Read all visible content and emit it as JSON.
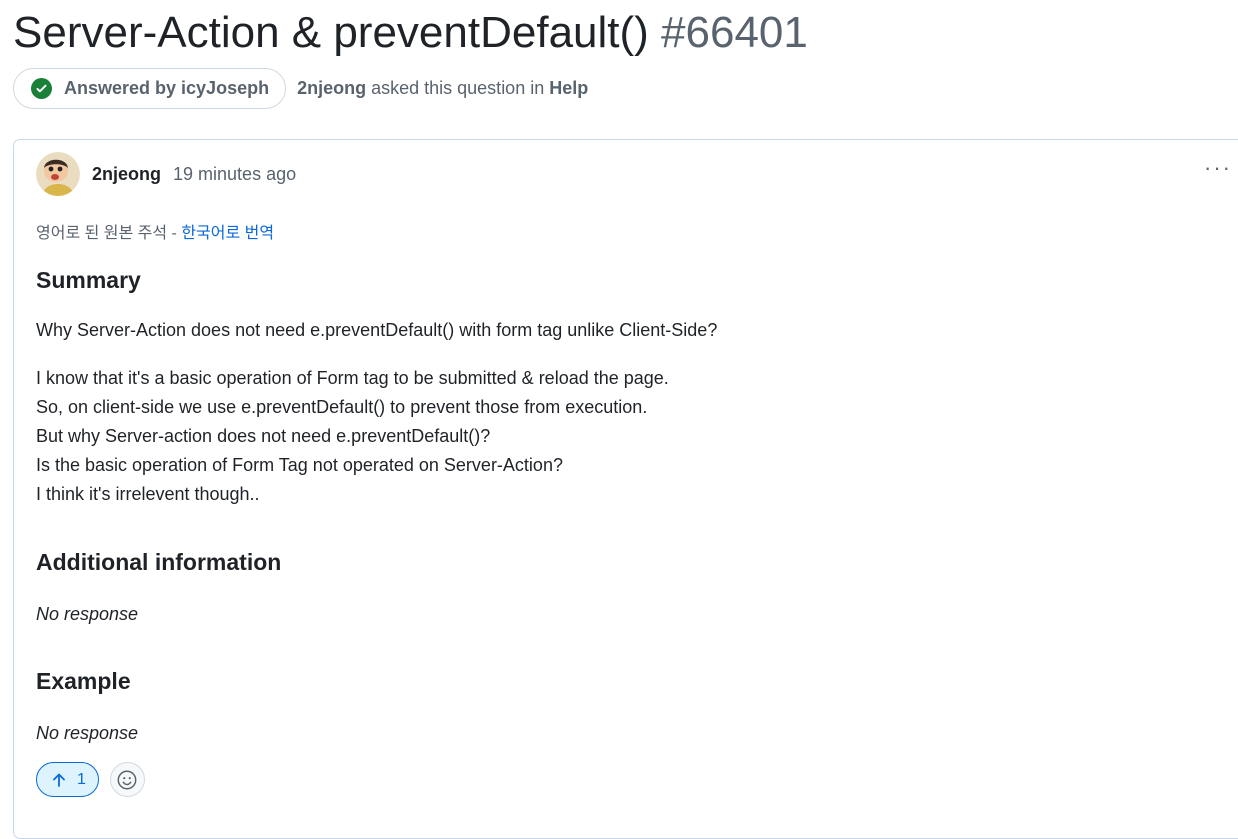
{
  "discussion": {
    "title": "Server-Action & preventDefault()",
    "number": "#66401",
    "answered_label": "Answered by icyJoseph",
    "asker": "2njeong",
    "asked_text": "asked this question in",
    "category": "Help"
  },
  "post": {
    "author": "2njeong",
    "time": "19 minutes ago",
    "translate_text": "영어로 된 원본 주석 - ",
    "translate_link": "한국어로 번역",
    "more_label": "···",
    "summary_heading": "Summary",
    "summary_line": "Why Server-Action does not need e.preventDefault() with form tag unlike Client-Side?",
    "body_lines": [
      "I know that it's a basic operation of Form tag to be submitted & reload the page.",
      "So, on client-side we use e.preventDefault() to prevent those from execution.",
      "But why Server-action does not need e.preventDefault()?",
      "Is the basic operation of Form Tag not operated on Server-Action?",
      "I think it's irrelevent though.."
    ],
    "additional_heading": "Additional information",
    "additional_text": "No response",
    "example_heading": "Example",
    "example_text": "No response"
  },
  "reactions": {
    "upvote_count": "1"
  },
  "icons": [
    "check-circle-icon",
    "kebab-icon",
    "arrow-up-icon",
    "smiley-icon"
  ],
  "colors": {
    "accent": "#0969da",
    "success": "#1a7f37",
    "muted": "#59636e",
    "text": "#1f2328"
  }
}
